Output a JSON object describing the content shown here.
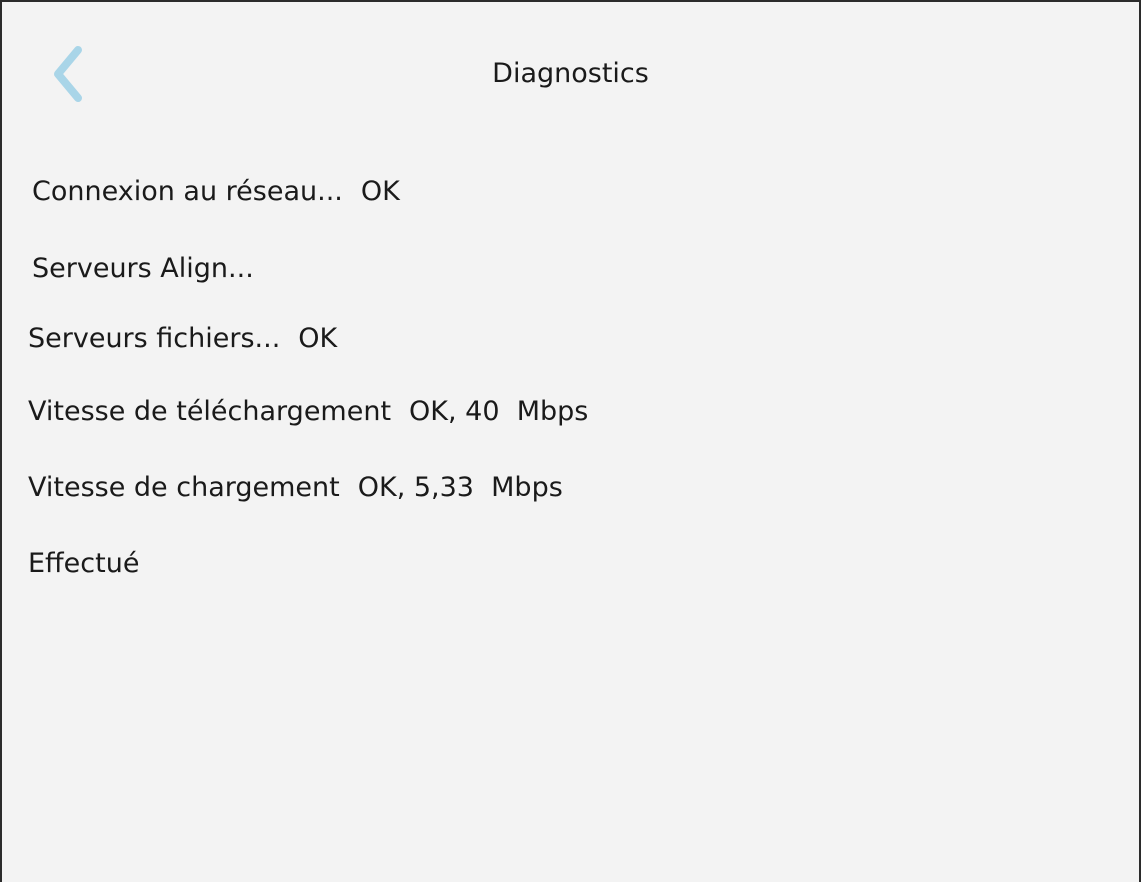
{
  "header": {
    "title": "Diagnostics",
    "back_icon": "chevron-left-icon",
    "back_icon_color": "#a9d5e8"
  },
  "diagnostics": {
    "network": {
      "label": "Connexion au réseau...",
      "value": "OK"
    },
    "align_servers": {
      "label": "Serveurs Align...",
      "value": ""
    },
    "file_servers": {
      "label": "Serveurs fichiers...",
      "value": "OK"
    },
    "download_speed": {
      "label": "Vitesse de téléchargement",
      "value": "OK, 40  Mbps"
    },
    "upload_speed": {
      "label": "Vitesse de chargement",
      "value": "OK, 5,33  Mbps"
    },
    "status": {
      "label": "Effectué"
    }
  },
  "colors": {
    "background": "#f3f3f3",
    "text": "#1a1a1a",
    "accent": "#a9d5e8"
  }
}
